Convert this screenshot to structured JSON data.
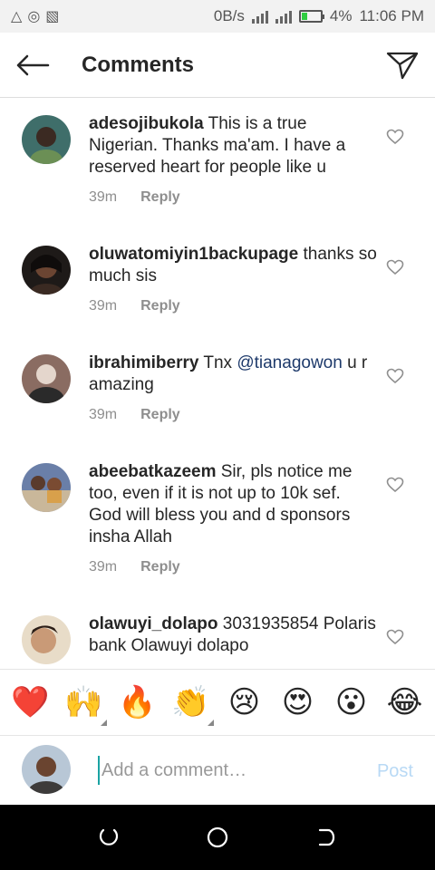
{
  "status_bar": {
    "net_speed": "0B/s",
    "battery": "4%",
    "time": "11:06 PM",
    "battery_level": 0.04
  },
  "header": {
    "title": "Comments",
    "back_icon": "back-arrow-icon",
    "send_icon": "paper-plane-icon"
  },
  "comments": [
    {
      "username": "adesojibukola",
      "text": " This is a true Nigerian. Thanks ma'am. I have a reserved heart for people like u",
      "time": "39m",
      "reply_label": "Reply",
      "avatar_color": "#3f6e6a"
    },
    {
      "username": "oluwatomiyin1backupage",
      "text": " thanks so much sis",
      "time": "39m",
      "reply_label": "Reply",
      "avatar_color": "#3a2a22"
    },
    {
      "username": "ibrahimiberry",
      "text": " Tnx ",
      "mention": "@tianagowon",
      "text_after": " u r amazing",
      "time": "39m",
      "reply_label": "Reply",
      "avatar_color": "#5a4a4a"
    },
    {
      "username": "abeebatkazeem",
      "text": " Sir, pls notice me too, even if it is not up to 10k sef. God will bless you and d sponsors insha Allah",
      "time": "39m",
      "reply_label": "Reply",
      "avatar_color": "#6a7fa8"
    },
    {
      "username": "olawuyi_dolapo",
      "text": " 3031935854 Polaris bank Olawuyi dolapo",
      "avatar_color": "#c99a77"
    }
  ],
  "emoji_bar": [
    "❤️",
    "🙌",
    "🔥",
    "👏",
    "😢",
    "😍",
    "😮",
    "😂"
  ],
  "composer": {
    "placeholder": "Add a comment…",
    "post_label": "Post",
    "post_color": "#b8d9f5"
  }
}
